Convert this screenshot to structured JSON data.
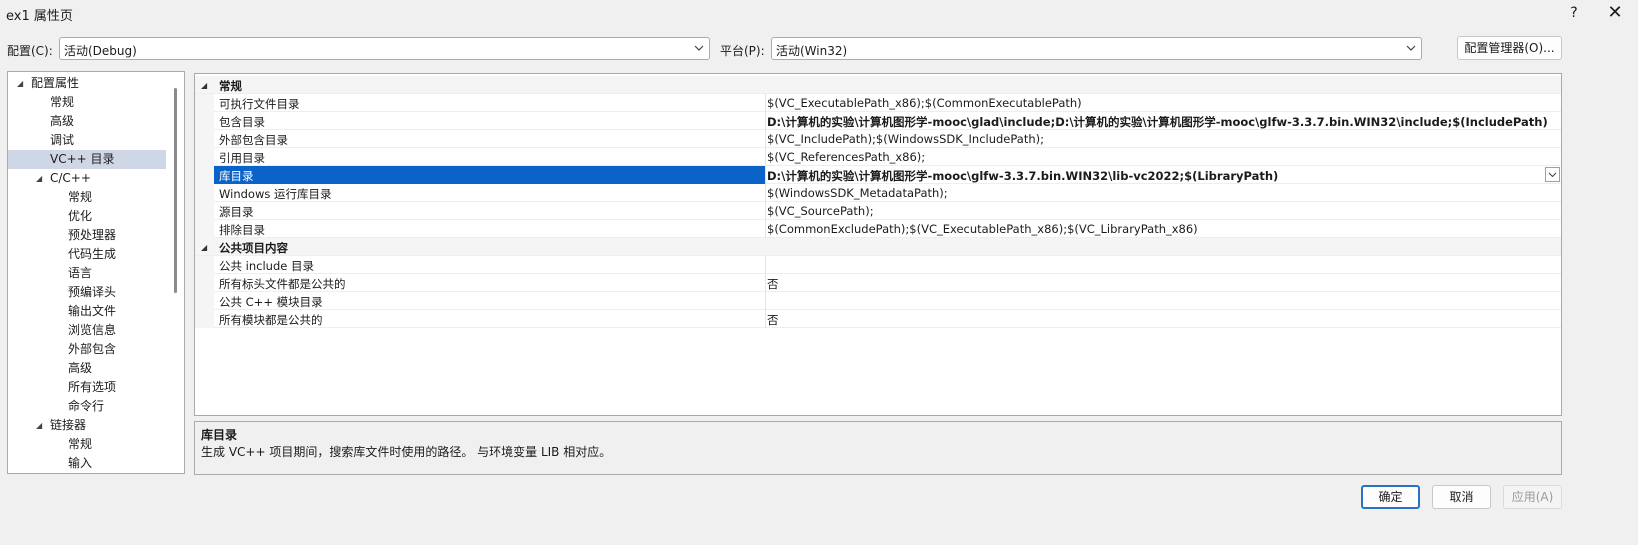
{
  "window": {
    "title": "ex1 属性页",
    "help": "?",
    "close": "✕"
  },
  "toolbar": {
    "config_label": "配置(C):",
    "config_value": "活动(Debug)",
    "platform_label": "平台(P):",
    "platform_value": "活动(Win32)",
    "config_manager": "配置管理器(O)..."
  },
  "tree": {
    "items": [
      {
        "label": "配置属性"
      },
      {
        "label": "常规"
      },
      {
        "label": "高级"
      },
      {
        "label": "调试"
      },
      {
        "label": "VC++ 目录"
      },
      {
        "label": "C/C++"
      },
      {
        "label": "常规"
      },
      {
        "label": "优化"
      },
      {
        "label": "预处理器"
      },
      {
        "label": "代码生成"
      },
      {
        "label": "语言"
      },
      {
        "label": "预编译头"
      },
      {
        "label": "输出文件"
      },
      {
        "label": "浏览信息"
      },
      {
        "label": "外部包含"
      },
      {
        "label": "高级"
      },
      {
        "label": "所有选项"
      },
      {
        "label": "命令行"
      },
      {
        "label": "链接器"
      },
      {
        "label": "常规"
      },
      {
        "label": "输入"
      }
    ]
  },
  "grid": {
    "categories": [
      "常规",
      "公共项目内容"
    ],
    "rows": [
      {
        "name": "可执行文件目录",
        "value": "$(VC_ExecutablePath_x86);$(CommonExecutablePath)"
      },
      {
        "name": "包含目录",
        "value": "D:\\计算机的实验\\计算机图形学-mooc\\glad\\include;D:\\计算机的实验\\计算机图形学-mooc\\glfw-3.3.7.bin.WIN32\\include;$(IncludePath)"
      },
      {
        "name": "外部包含目录",
        "value": "$(VC_IncludePath);$(WindowsSDK_IncludePath);"
      },
      {
        "name": "引用目录",
        "value": "$(VC_ReferencesPath_x86);"
      },
      {
        "name": "库目录",
        "value": "D:\\计算机的实验\\计算机图形学-mooc\\glfw-3.3.7.bin.WIN32\\lib-vc2022;$(LibraryPath)"
      },
      {
        "name": "Windows 运行库目录",
        "value": "$(WindowsSDK_MetadataPath);"
      },
      {
        "name": "源目录",
        "value": "$(VC_SourcePath);"
      },
      {
        "name": "排除目录",
        "value": "$(CommonExcludePath);$(VC_ExecutablePath_x86);$(VC_LibraryPath_x86)"
      },
      {
        "name": "公共 include 目录",
        "value": ""
      },
      {
        "name": "所有标头文件都是公共的",
        "value": "否"
      },
      {
        "name": "公共 C++ 模块目录",
        "value": ""
      },
      {
        "name": "所有模块都是公共的",
        "value": "否"
      }
    ]
  },
  "description": {
    "title": "库目录",
    "text": "生成 VC++ 项目期间，搜索库文件时使用的路径。 与环境变量 LIB 相对应。"
  },
  "buttons": {
    "ok": "确定",
    "cancel": "取消",
    "apply": "应用(A)"
  }
}
